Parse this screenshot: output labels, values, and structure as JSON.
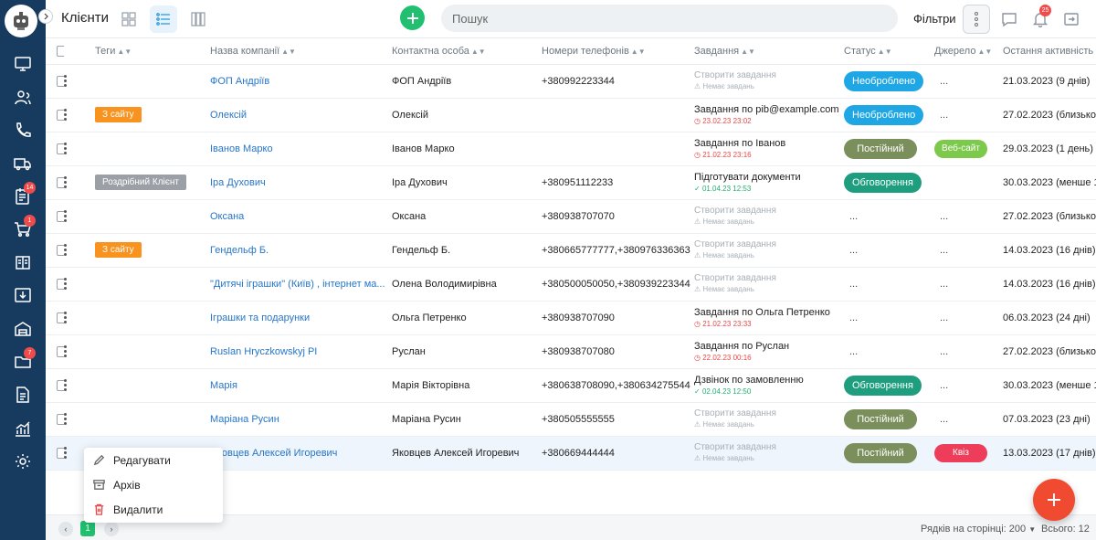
{
  "header": {
    "title": "Клієнти",
    "search_placeholder": "Пошук",
    "filters_label": "Фільтри",
    "notification_count": "25"
  },
  "sidebar": {
    "items": [
      {
        "name": "monitor-icon",
        "badge": ""
      },
      {
        "name": "users-icon",
        "badge": ""
      },
      {
        "name": "phone-icon",
        "badge": ""
      },
      {
        "name": "truck-icon",
        "badge": ""
      },
      {
        "name": "notepad-icon",
        "badge": "14"
      },
      {
        "name": "cart-icon",
        "badge": "1"
      },
      {
        "name": "books-icon",
        "badge": ""
      },
      {
        "name": "download-box-icon",
        "badge": ""
      },
      {
        "name": "warehouse-icon",
        "badge": ""
      },
      {
        "name": "folder-icon",
        "badge": "7"
      },
      {
        "name": "document-icon",
        "badge": ""
      },
      {
        "name": "chart-icon",
        "badge": ""
      },
      {
        "name": "gear-icon",
        "badge": ""
      }
    ]
  },
  "table": {
    "columns": [
      "Теги",
      "Назва компанії",
      "Контактна особа",
      "Номери телефонів",
      "Завдання",
      "Статус",
      "Джерело",
      "Остання активність"
    ],
    "rows": [
      {
        "tag": "",
        "tag_color": "",
        "company": "ФОП Андріїв",
        "contact": "ФОП Андріїв",
        "phone": "+380992223344",
        "task_title": "",
        "task_sub": "Немає завдань",
        "task_type": "empty",
        "status": "Необроблено",
        "status_color": "#1ea7e4",
        "source": "...",
        "source_color": "",
        "activity": "21.03.2023 (9 днів)"
      },
      {
        "tag": "З сайту",
        "tag_color": "#f7931e",
        "company": "Олексій",
        "contact": "Олексій",
        "phone": "",
        "task_title": "Завдання по pib@example.com",
        "task_sub": "23.02.23 23:02",
        "task_type": "red",
        "status": "Необроблено",
        "status_color": "#1ea7e4",
        "source": "...",
        "source_color": "",
        "activity": "27.02.2023 (близько 1 місяця)"
      },
      {
        "tag": "",
        "tag_color": "",
        "company": "Іванов Марко",
        "contact": "Іванов Марко",
        "phone": "",
        "task_title": "Завдання по Іванов",
        "task_sub": "21.02.23 23:16",
        "task_type": "red",
        "status": "Постійний",
        "status_color": "#7a8f5c",
        "source": "Веб-сайт",
        "source_color": "#7cc94b",
        "activity": "29.03.2023 (1 день)"
      },
      {
        "tag": "Роздрібний Клієнт",
        "tag_color": "#9aa0a6",
        "company": "Іра Духович",
        "contact": "Іра Духович",
        "phone": "+380951112233",
        "task_title": "Підготувати документи",
        "task_sub": "01.04.23 12:53",
        "task_type": "green",
        "status": "Обговорення",
        "status_color": "#1e9e7e",
        "source": "",
        "source_color": "",
        "activity": "30.03.2023 (менше 1 хвилини)"
      },
      {
        "tag": "",
        "tag_color": "",
        "company": "Оксана",
        "contact": "Оксана",
        "phone": "+380938707070",
        "task_title": "",
        "task_sub": "Немає завдань",
        "task_type": "empty",
        "status": "...",
        "status_color": "",
        "source": "...",
        "source_color": "",
        "activity": "27.02.2023 (близько 1 місяця)"
      },
      {
        "tag": "З сайту",
        "tag_color": "#f7931e",
        "company": "Гендельф Б.",
        "contact": "Гендельф Б.",
        "phone": "+380665777777,+380976336363",
        "task_title": "",
        "task_sub": "Немає завдань",
        "task_type": "empty",
        "status": "...",
        "status_color": "",
        "source": "...",
        "source_color": "",
        "activity": "14.03.2023 (16 днів)"
      },
      {
        "tag": "",
        "tag_color": "",
        "company": "\"Дитячі іграшки\" (Київ) , інтернет ма...",
        "contact": "Олена Володимирівна",
        "phone": "+380500050050,+380939223344",
        "task_title": "",
        "task_sub": "Немає завдань",
        "task_type": "empty",
        "status": "...",
        "status_color": "",
        "source": "...",
        "source_color": "",
        "activity": "14.03.2023 (16 днів)"
      },
      {
        "tag": "",
        "tag_color": "",
        "company": "Іграшки та подарунки",
        "contact": "Ольга Петренко",
        "phone": "+380938707090",
        "task_title": "Завдання по Ольга Петренко",
        "task_sub": "21.02.23 23:33",
        "task_type": "red",
        "status": "...",
        "status_color": "",
        "source": "...",
        "source_color": "",
        "activity": "06.03.2023 (24 дні)"
      },
      {
        "tag": "",
        "tag_color": "",
        "company": "Ruslan Hryczkowskyj PI",
        "contact": "Руслан",
        "phone": "+380938707080",
        "task_title": "Завдання по Руслан",
        "task_sub": "22.02.23 00:16",
        "task_type": "red",
        "status": "...",
        "status_color": "",
        "source": "...",
        "source_color": "",
        "activity": "27.02.2023 (близько 1 місяця)"
      },
      {
        "tag": "",
        "tag_color": "",
        "company": "Марія",
        "contact": "Марія Вікторівна",
        "phone": "+380638708090,+380634275544",
        "task_title": "Дзвінок по замовленню",
        "task_sub": "02.04.23 12:50",
        "task_type": "green",
        "status": "Обговорення",
        "status_color": "#1e9e7e",
        "source": "...",
        "source_color": "",
        "activity": "30.03.2023 (менше 1 хвилини)"
      },
      {
        "tag": "",
        "tag_color": "",
        "company": "Маріана Русин",
        "contact": "Маріана Русин",
        "phone": "+380505555555",
        "task_title": "",
        "task_sub": "Немає завдань",
        "task_type": "empty",
        "status": "Постійний",
        "status_color": "#7a8f5c",
        "source": "...",
        "source_color": "",
        "activity": "07.03.2023 (23 дні)"
      },
      {
        "tag": "",
        "tag_color": "",
        "company": "Яковцев Алексей Игоревич",
        "contact": "Яковцев Алексей Игоревич",
        "phone": "+380669444444",
        "task_title": "",
        "task_sub": "Немає завдань",
        "task_type": "empty",
        "status": "Постійний",
        "status_color": "#7a8f5c",
        "source": "Квіз",
        "source_color": "#ee3d5a",
        "activity": "13.03.2023 (17 днів)"
      }
    ],
    "create_task_label": "Створити завдання"
  },
  "context_menu": {
    "items": [
      "Редагувати",
      "Архів",
      "Видалити"
    ]
  },
  "footer": {
    "page": "1",
    "rows_per_page_label": "Рядків на сторінці: 200",
    "total_label": "Всього: 12"
  },
  "colors": {
    "sidebar_bg": "#173b5e",
    "accent_green": "#20c070",
    "fab": "#f04a30",
    "link": "#2776c9"
  }
}
